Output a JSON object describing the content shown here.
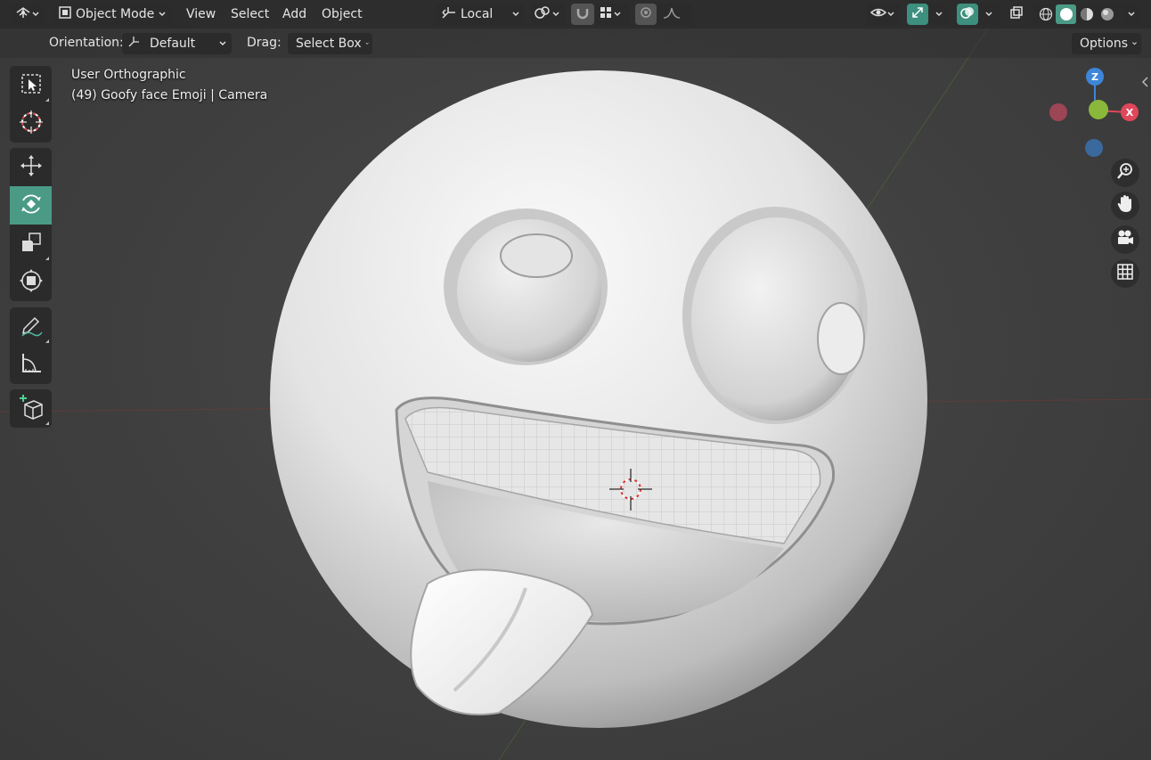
{
  "header": {
    "editor_type_icon": "editor-type-icon",
    "mode": "Object Mode",
    "menus": [
      "View",
      "Select",
      "Add",
      "Object"
    ],
    "transform_orientation": "Local",
    "options_label": "Options"
  },
  "tool_header": {
    "orientation_label": "Orientation:",
    "orientation_value": "Default",
    "drag_label": "Drag:",
    "drag_value": "Select Box"
  },
  "viewport": {
    "view_name": "User Orthographic",
    "object_info": "(49) Goofy face Emoji | Camera"
  },
  "toolbar": [
    {
      "group": "select",
      "items": [
        "select-box-icon",
        "cursor-icon"
      ]
    },
    {
      "group": "transform",
      "items": [
        "move-icon",
        "rotate-icon",
        "scale-icon",
        "transform-icon"
      ],
      "active": "rotate-icon"
    },
    {
      "group": "annotate",
      "items": [
        "annotate-icon",
        "measure-icon"
      ]
    },
    {
      "group": "add",
      "items": [
        "add-cube-icon"
      ]
    }
  ],
  "gizmo": {
    "axes": [
      "X",
      "Y",
      "Z"
    ],
    "colors": {
      "x": "#e0475a",
      "y": "#8ab83a",
      "z": "#3d86d8"
    }
  },
  "navigation": [
    "zoom-icon",
    "hand-pan-icon",
    "camera-icon",
    "grid-icon"
  ],
  "colors": {
    "header_bg": "#2b2b2b",
    "viewport_bg": "#3d3d3d",
    "active_tool": "#4a9a86",
    "accent_green": "#3d8f7e"
  }
}
